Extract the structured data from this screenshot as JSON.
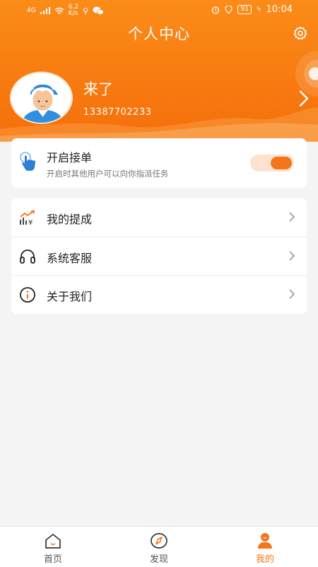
{
  "status_bar": {
    "network": "4G",
    "speed_value": "6.2",
    "speed_unit": "K/s",
    "battery": "91",
    "time": "10:04"
  },
  "header": {
    "title": "个人中心",
    "settings_icon": "gear-icon"
  },
  "profile": {
    "name": "来了",
    "phone": "13387702233",
    "avatar_icon": "worker-avatar"
  },
  "order_switch": {
    "title": "开启接单",
    "subtitle": "开启时其他用户可以向你指派任务",
    "enabled": true,
    "icon": "tap-hand-icon"
  },
  "menu": {
    "items": [
      {
        "label": "我的提成",
        "icon": "commission-icon"
      },
      {
        "label": "系统客服",
        "icon": "headset-icon"
      },
      {
        "label": "关于我们",
        "icon": "info-icon"
      }
    ]
  },
  "tab_bar": {
    "tabs": [
      {
        "label": "首页",
        "icon": "home-icon",
        "active": false
      },
      {
        "label": "发现",
        "icon": "compass-icon",
        "active": false
      },
      {
        "label": "我的",
        "icon": "profile-icon",
        "active": true
      }
    ]
  },
  "colors": {
    "brand": "#f77a10",
    "accent": "#f4761a",
    "toggle_track": "#fde3cf",
    "background": "#f4f4f4"
  }
}
